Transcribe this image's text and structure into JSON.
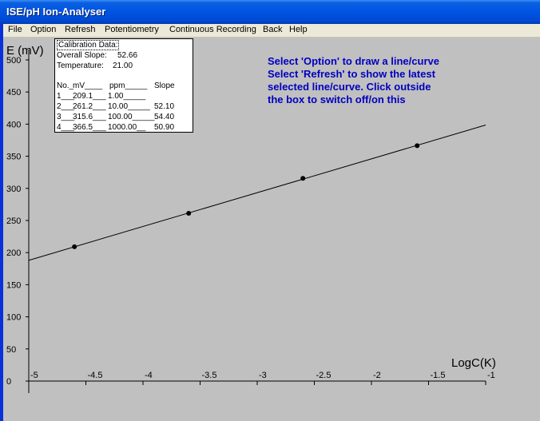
{
  "window": {
    "title": "ISE/pH Ion-Analyser"
  },
  "menu": {
    "items": [
      "File",
      "Option",
      "Refresh",
      "Potentiometry",
      "Continuous Recording",
      "Back",
      "Help"
    ]
  },
  "calibration": {
    "title": "Calibration Data:",
    "overall_slope_label": "Overall Slope:",
    "overall_slope_value": "52.66",
    "temperature_label": "Temperature:",
    "temperature_value": "21.00",
    "header": {
      "no": "No._",
      "mv": "mV____",
      "ppm": "ppm_____",
      "slope": "Slope"
    },
    "rows": [
      {
        "no": "1___",
        "mv": "209.1___",
        "ppm": "1.00_____",
        "slope": ""
      },
      {
        "no": "2___",
        "mv": "261.2___",
        "ppm": "10.00_____",
        "slope": "52.10"
      },
      {
        "no": "3___",
        "mv": "315.6___",
        "ppm": "100.00_____",
        "slope": "54.40"
      },
      {
        "no": "4___",
        "mv": "366.5___",
        "ppm": "1000.00__",
        "slope": "50.90"
      }
    ]
  },
  "info": {
    "lines": [
      "Select 'Option' to draw a line/curve",
      "Select 'Refresh' to show the latest",
      "selected line/curve. Click outside",
      "the box to switch off/on this"
    ],
    "color": "#0000c0"
  },
  "chart_data": {
    "type": "scatter",
    "xlabel": "LogC(K)",
    "ylabel": "E (mV)",
    "xlim": [
      -5,
      -1
    ],
    "ylim": [
      0,
      500
    ],
    "x_ticks": [
      "-5",
      "-4.5",
      "-4",
      "-3.5",
      "-3",
      "-2.5",
      "-2",
      "-1.5",
      "-1"
    ],
    "y_ticks": [
      "0",
      "50",
      "100",
      "150",
      "200",
      "250",
      "300",
      "350",
      "400",
      "450",
      "500"
    ],
    "series": [
      {
        "points": [
          {
            "x": -4.6,
            "y": 209.1
          },
          {
            "x": -3.6,
            "y": 261.2
          },
          {
            "x": -2.6,
            "y": 315.6
          },
          {
            "x": -1.6,
            "y": 366.5
          }
        ]
      }
    ],
    "fit_line": {
      "x": [
        -5,
        -1
      ],
      "y": [
        188.0,
        398.6
      ]
    },
    "grid": false
  }
}
